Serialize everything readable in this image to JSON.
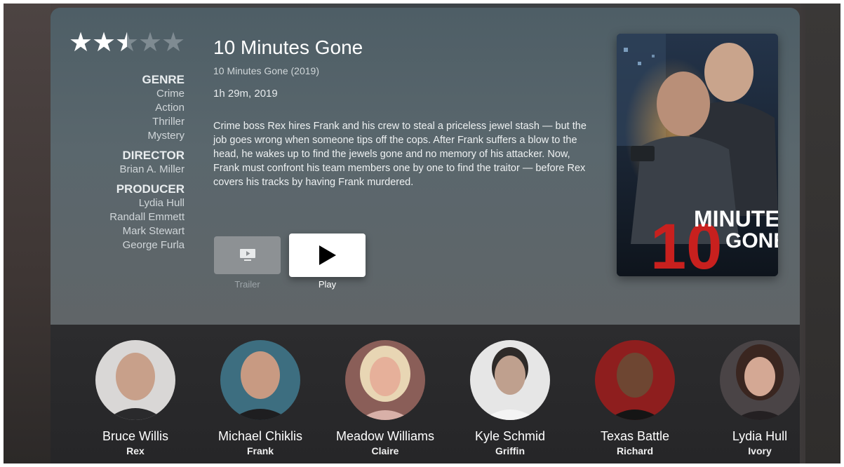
{
  "movie": {
    "title": "10 Minutes Gone",
    "subtitle": "10 Minutes Gone (2019)",
    "runtime": "1h 29m,  2019",
    "rating": 2.5,
    "rating_max": 5,
    "description": "Crime boss Rex hires Frank and his crew to steal a priceless jewel stash — but the job goes wrong when someone tips off the cops. After Frank suffers a blow to the head, he wakes up to find the jewels gone and no memory of his attacker. Now, Frank must confront his team members one by one to find the traitor — before Rex covers his tracks by having Frank murdered."
  },
  "details": {
    "genre_header": "GENRE",
    "genres": [
      "Crime",
      "Action",
      "Thriller",
      "Mystery"
    ],
    "director_header": "DIRECTOR",
    "director": "Brian A. Miller",
    "producer_header": "PRODUCER",
    "producers": [
      "Lydia Hull",
      "Randall Emmett",
      "Mark Stewart",
      "George Furla"
    ]
  },
  "actions": {
    "trailer_label": "Trailer",
    "play_label": "Play"
  },
  "poster": {
    "title_number": "10",
    "title_word1": "MINUTES",
    "title_word2": "GONE"
  },
  "cast": [
    {
      "name": "Bruce Willis",
      "role": "Rex"
    },
    {
      "name": "Michael Chiklis",
      "role": "Frank"
    },
    {
      "name": "Meadow Williams",
      "role": "Claire"
    },
    {
      "name": "Kyle Schmid",
      "role": "Griffin"
    },
    {
      "name": "Texas Battle",
      "role": "Richard"
    },
    {
      "name": "Lydia Hull",
      "role": "Ivory"
    }
  ],
  "colors": {
    "card_top": "#4e5e66",
    "cast_strip": "#2c2c2e",
    "accent_red": "#c8201e",
    "star_filled": "#ffffff",
    "star_empty": "#7f8b92"
  }
}
